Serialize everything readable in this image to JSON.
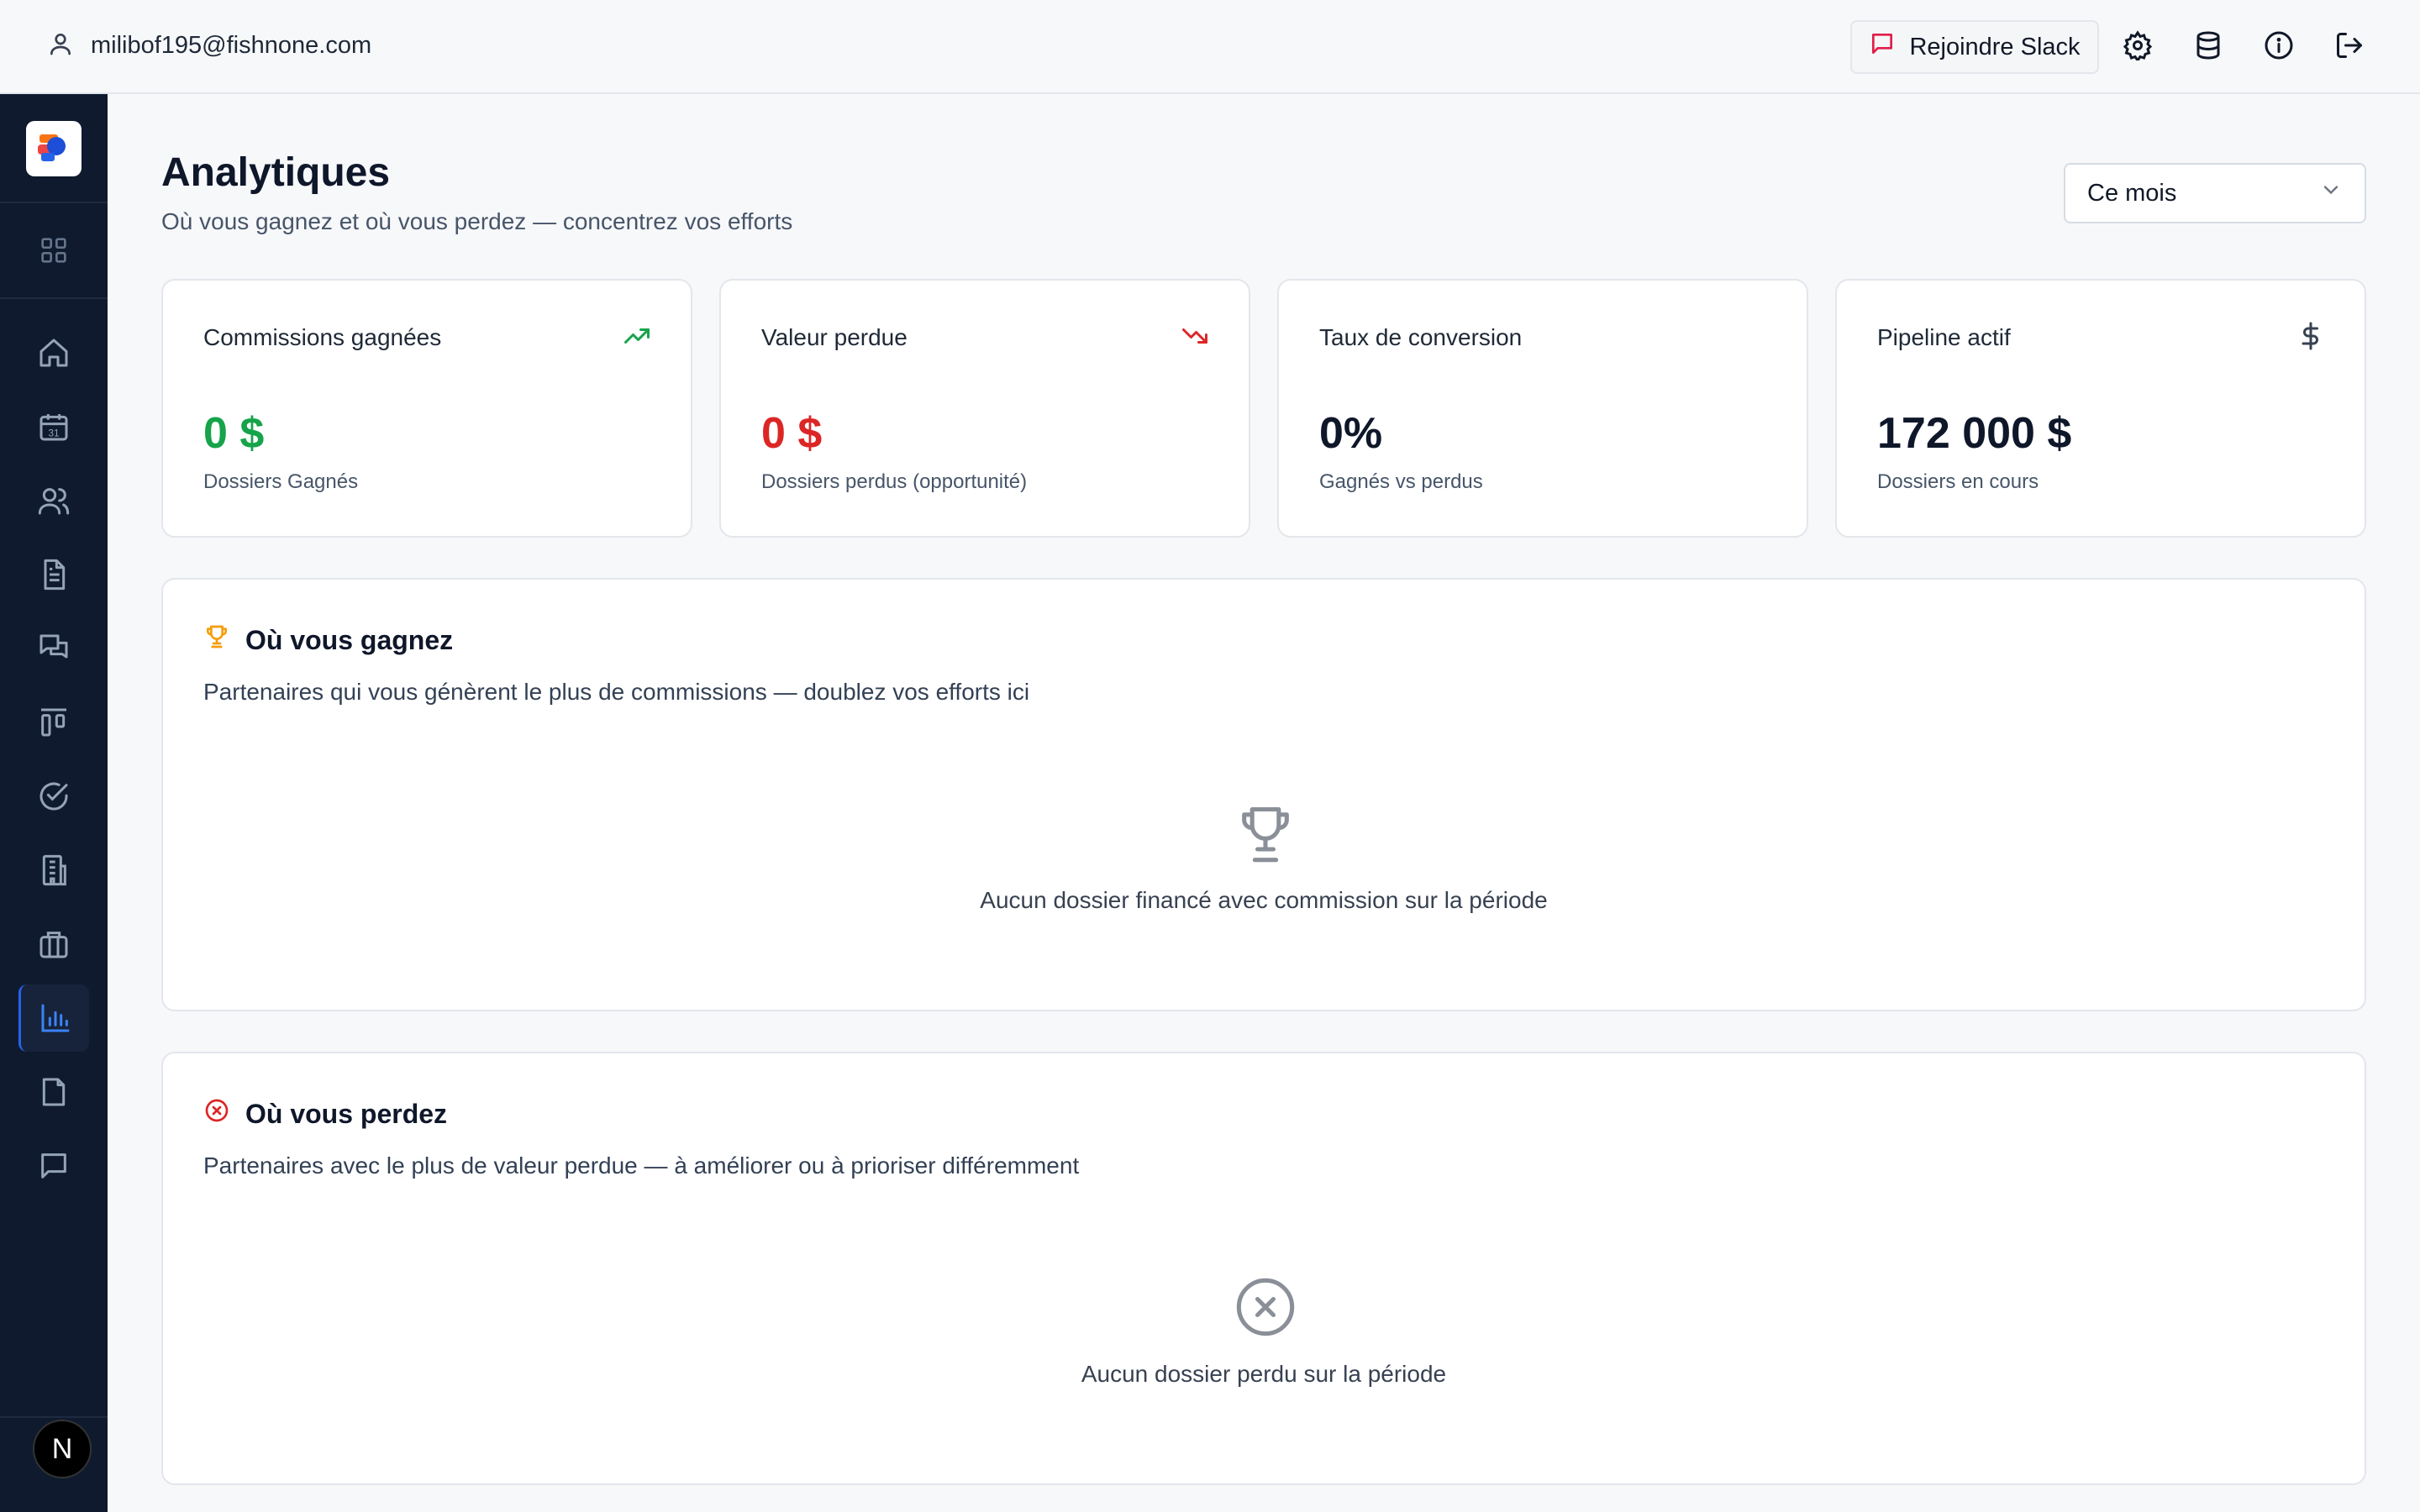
{
  "user": {
    "email": "milibof195@fishnone.com"
  },
  "topbar": {
    "slack_label": "Rejoindre Slack"
  },
  "page": {
    "title": "Analytiques",
    "subtitle": "Où vous gagnez et où vous perdez — concentrez vos efforts",
    "period_selected": "Ce mois"
  },
  "sidebar": {
    "items": [
      "dashboard",
      "calendar",
      "contacts",
      "documents",
      "messages",
      "pipeline",
      "tasks",
      "companies",
      "portfolio",
      "analytics",
      "files",
      "chat"
    ],
    "active": "analytics",
    "avatar_letter": "N"
  },
  "kpis": [
    {
      "title": "Commissions gagnées",
      "value": "0 $",
      "caption": "Dossiers Gagnés",
      "icon": "trending-up-icon",
      "color": "#16a34a"
    },
    {
      "title": "Valeur perdue",
      "value": "0 $",
      "caption": "Dossiers perdus (opportunité)",
      "icon": "trending-down-icon",
      "color": "#dc2626"
    },
    {
      "title": "Taux de conversion",
      "value": "0%",
      "caption": "Gagnés vs perdus",
      "icon": "",
      "color": "#0f172a"
    },
    {
      "title": "Pipeline actif",
      "value": "172 000 $",
      "caption": "Dossiers en cours",
      "icon": "dollar-icon",
      "color": "#0f172a"
    }
  ],
  "win_panel": {
    "title": "Où vous gagnez",
    "description": "Partenaires qui vous génèrent le plus de commissions — doublez vos efforts ici",
    "empty_text": "Aucun dossier financé avec commission sur la période"
  },
  "loss_panel": {
    "title": "Où vous perdez",
    "description": "Partenaires avec le plus de valeur perdue — à améliorer ou à prioriser différemment",
    "empty_text": "Aucun dossier perdu sur la période"
  },
  "colors": {
    "accent": "#2563eb",
    "win": "#16a34a",
    "loss": "#dc2626",
    "trophy": "#f59e0b",
    "sidebar": "#0f1a2e"
  }
}
